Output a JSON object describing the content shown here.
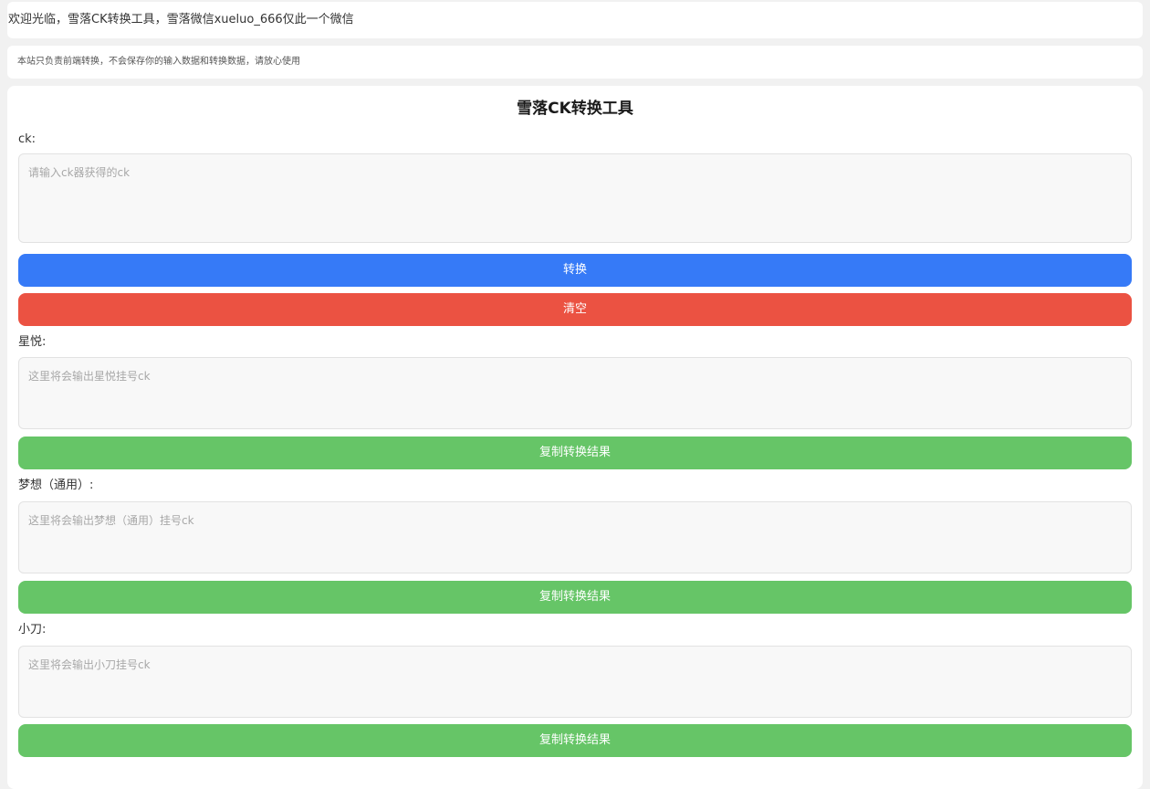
{
  "banner": {
    "welcome": "欢迎光临，雪落CK转换工具，雪落微信xueluo_666仅此一个微信",
    "notice": "本站只负责前端转换，不会保存你的输入数据和转换数据，请放心使用"
  },
  "tool": {
    "title": "雪落CK转换工具",
    "ck": {
      "label": "ck:",
      "placeholder": "请输入ck器获得的ck",
      "value": ""
    },
    "convert_button": {
      "label": "转换",
      "color": "#367af7"
    },
    "clear_button": {
      "label": "清空",
      "color": "#eb5242"
    },
    "outputs": [
      {
        "label": "星悦:",
        "placeholder": "这里将会输出星悦挂号ck",
        "value": "",
        "copy_label": "复制转换结果"
      },
      {
        "label": "梦想（通用）:",
        "placeholder": "这里将会输出梦想（通用）挂号ck",
        "value": "",
        "copy_label": "复制转换结果"
      },
      {
        "label": "小刀:",
        "placeholder": "这里将会输出小刀挂号ck",
        "value": "",
        "copy_label": "复制转换结果"
      }
    ],
    "copy_button_color": "#66c567"
  }
}
